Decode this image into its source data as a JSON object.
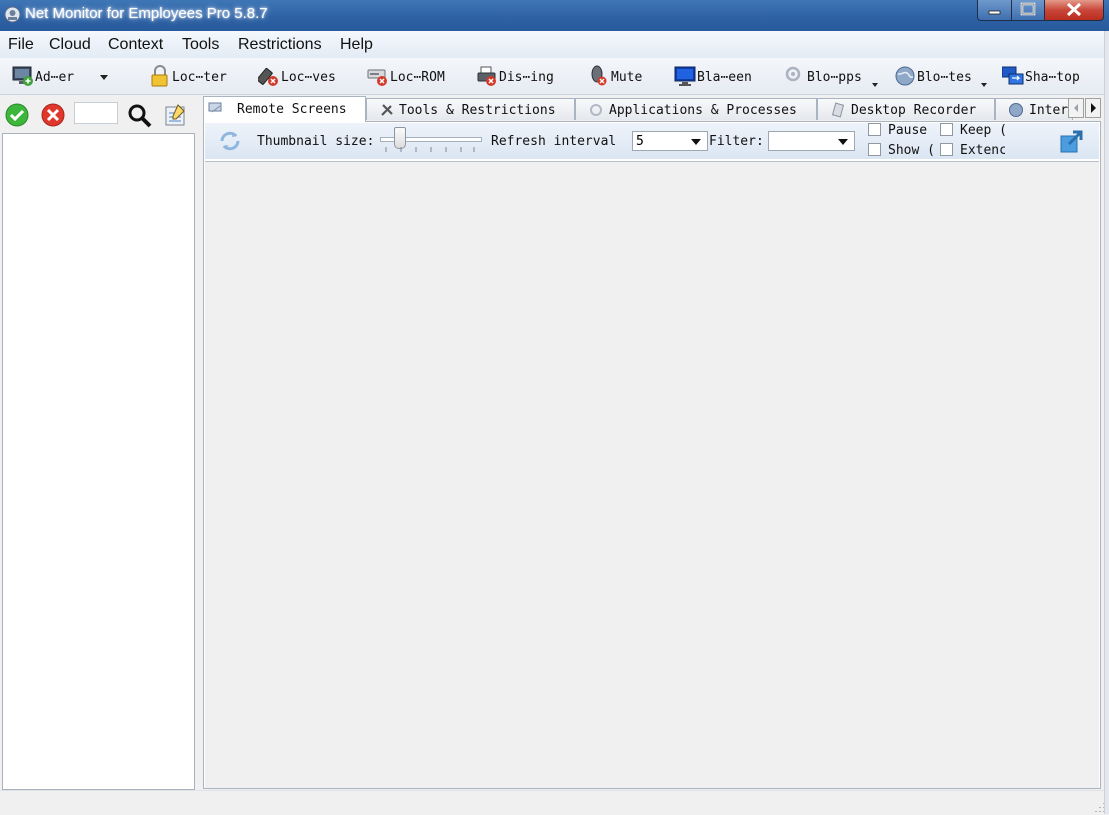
{
  "window": {
    "title": "Net Monitor for Employees Pro 5.8.7"
  },
  "menu": [
    "File",
    "Cloud",
    "Context",
    "Tools",
    "Restrictions",
    "Help"
  ],
  "toolbar": {
    "items": [
      {
        "label": "Ad⋯er",
        "icon": "add-computer-icon"
      },
      {
        "label": "Loc⋯ter",
        "icon": "lock-icon"
      },
      {
        "label": "Loc⋯ves",
        "icon": "usb-drive-icon"
      },
      {
        "label": "Loc⋯ROM",
        "icon": "cdrom-icon"
      },
      {
        "label": "Dis⋯ing",
        "icon": "printer-icon"
      },
      {
        "label": "Mute",
        "icon": "mouse-mute-icon"
      },
      {
        "label": "Bla⋯een",
        "icon": "monitor-icon"
      },
      {
        "label": "Blo⋯pps",
        "icon": "apps-icon"
      },
      {
        "label": "Blo⋯tes",
        "icon": "globe-icon"
      },
      {
        "label": "Sha⋯top",
        "icon": "share-desktop-icon"
      }
    ]
  },
  "tabs": [
    {
      "label": "Remote Screens",
      "active": true
    },
    {
      "label": "Tools & Restrictions",
      "active": false
    },
    {
      "label": "Applications & Processes",
      "active": false
    },
    {
      "label": "Desktop Recorder",
      "active": false
    },
    {
      "label": "Inter",
      "active": false
    }
  ],
  "remote_screens": {
    "thumbnail_label": "Thumbnail size:",
    "refresh_label": "Refresh interval",
    "refresh_value": "5",
    "filter_label": "Filter:",
    "filter_value": "",
    "checkboxes": [
      {
        "label": "Pause",
        "checked": false
      },
      {
        "label": "Keep (",
        "checked": false
      },
      {
        "label": "Show (",
        "checked": false
      },
      {
        "label": "Extenc",
        "checked": false
      }
    ]
  }
}
